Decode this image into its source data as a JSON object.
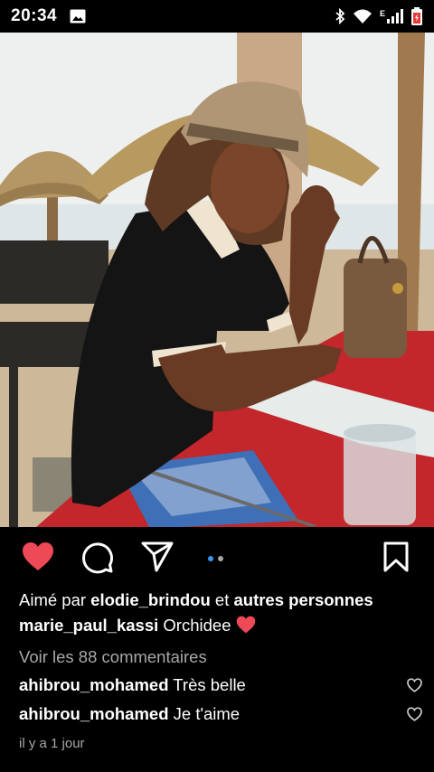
{
  "status_bar": {
    "time": "20:34",
    "network_label": "E",
    "icons": [
      "image-icon",
      "bluetooth-icon",
      "wifi-icon",
      "signal-icon",
      "battery-icon"
    ]
  },
  "post": {
    "image_alt": "Photo d'une femme assise à une table au bord de la plage",
    "carousel": {
      "count": 2,
      "active_index": 0
    },
    "likes": {
      "prefix": "Aimé par ",
      "user": "elodie_brindou",
      "suffix": " et ",
      "others": "autres personnes"
    },
    "caption": {
      "author": "marie_paul_kassi",
      "text": " Orchidee ",
      "emoji": "❤️"
    },
    "view_comments": "Voir les 88 commentaires",
    "comments": [
      {
        "user": "ahibrou_mohamed",
        "text": " Très belle"
      },
      {
        "user": "ahibrou_mohamed",
        "text": " Je t'aime"
      }
    ],
    "timestamp": "il y a 1 jour"
  },
  "colors": {
    "like_red": "#ed4956",
    "carousel_active": "#3797f0",
    "muted_text": "#a8a8a8"
  }
}
